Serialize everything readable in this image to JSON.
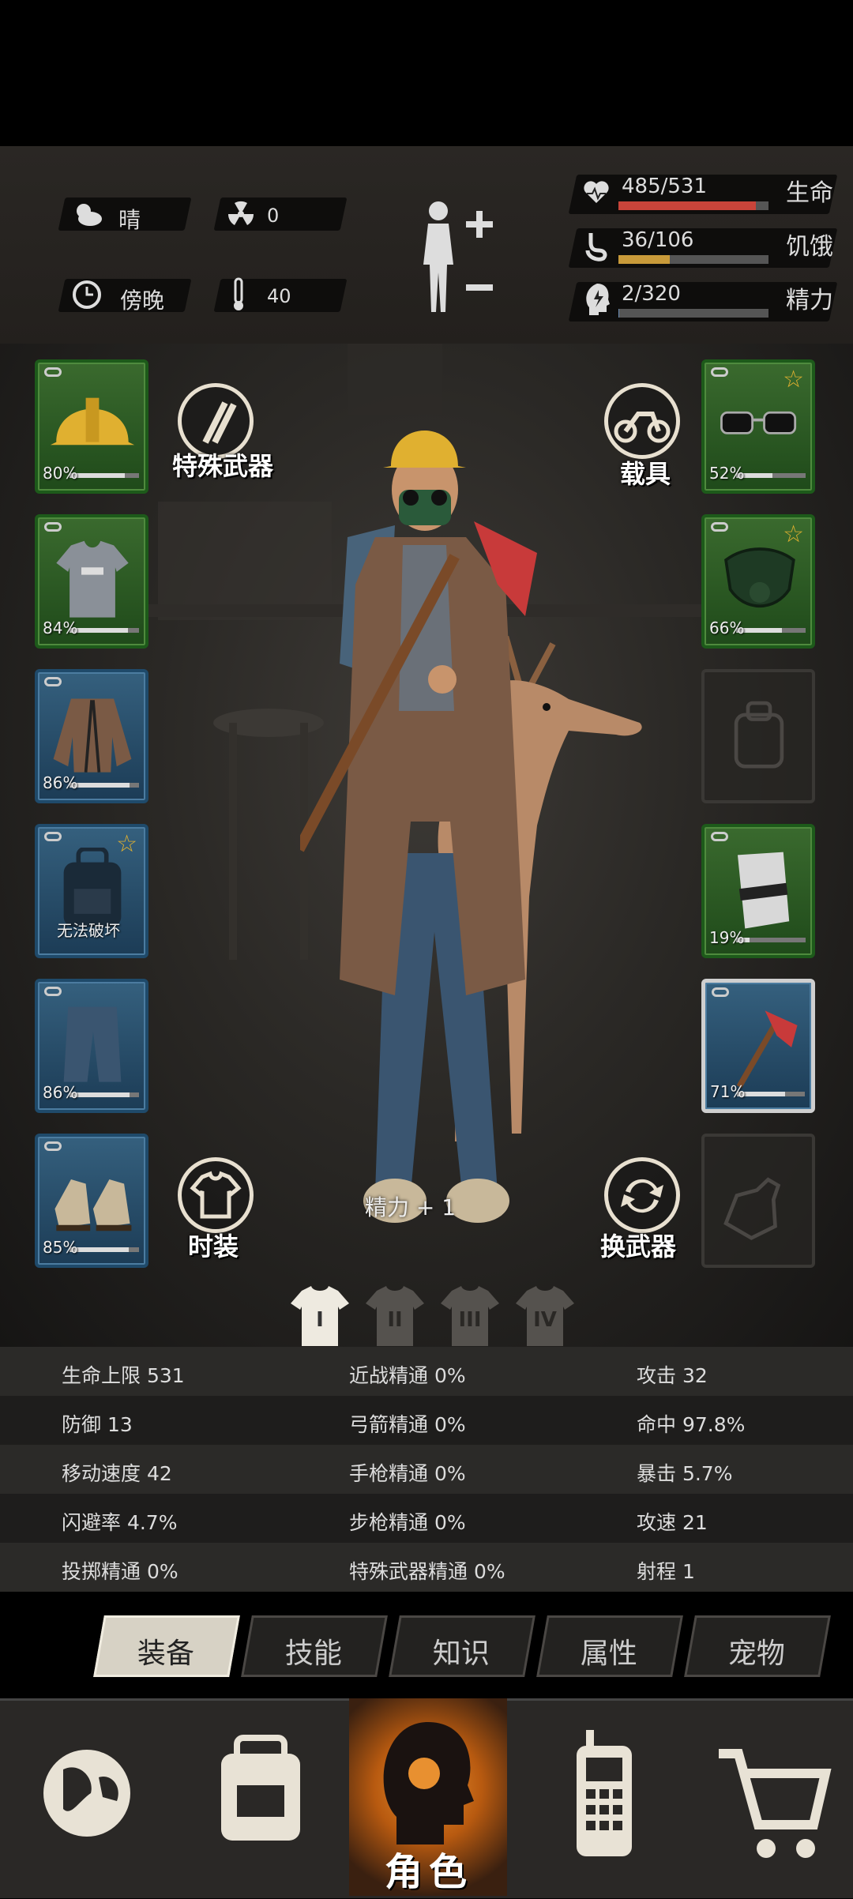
{
  "status": {
    "weather": "晴",
    "radiation": "0",
    "time_of_day": "傍晚",
    "temperature": "40",
    "health": {
      "label": "生命",
      "text": "485/531",
      "current": 485,
      "max": 531,
      "color": "#c8443a"
    },
    "hunger": {
      "label": "饥饿",
      "text": "36/106",
      "current": 36,
      "max": 106,
      "color": "#c89a3a"
    },
    "energy": {
      "label": "精力",
      "text": "2/320",
      "current": 2,
      "max": 320,
      "color": "#6a8ab0"
    }
  },
  "character": {
    "special_weapon_label": "特殊武器",
    "vehicle_label": "载具",
    "costume_label": "时装",
    "switch_weapon_label": "换武器",
    "shoe_bonus": "精力 + 1"
  },
  "left_slots": [
    {
      "icon": "hard-hat-icon",
      "pct": "80%",
      "value": 0.8,
      "rarity": "green",
      "star": false
    },
    {
      "icon": "tshirt-icon",
      "pct": "84%",
      "value": 0.84,
      "rarity": "green",
      "star": false
    },
    {
      "icon": "coat-icon",
      "pct": "86%",
      "value": 0.86,
      "rarity": "blue",
      "star": false
    },
    {
      "icon": "backpack-icon",
      "pct": "无法破坏",
      "rarity": "blue",
      "star": true
    },
    {
      "icon": "jeans-icon",
      "pct": "86%",
      "value": 0.86,
      "rarity": "blue",
      "star": false
    },
    {
      "icon": "sneakers-icon",
      "pct": "85%",
      "value": 0.85,
      "rarity": "blue",
      "star": false
    }
  ],
  "right_slots": [
    {
      "icon": "glasses-icon",
      "pct": "52%",
      "value": 0.52,
      "rarity": "green",
      "star": true
    },
    {
      "icon": "gas-mask-icon",
      "pct": "66%",
      "value": 0.66,
      "rarity": "green",
      "star": true
    },
    {
      "icon": "empty-pack-icon",
      "rarity": "empty"
    },
    {
      "icon": "bandage-roll-icon",
      "pct": "19%",
      "value": 0.19,
      "rarity": "green",
      "star": false
    },
    {
      "icon": "fire-axe-icon",
      "pct": "71%",
      "value": 0.71,
      "rarity": "blue",
      "star": false,
      "selected": true
    },
    {
      "icon": "empty-bottle-icon",
      "rarity": "empty"
    }
  ],
  "outfit_sets": [
    "I",
    "II",
    "III",
    "IV"
  ],
  "stats": [
    [
      "生命上限 531",
      "近战精通 0%",
      "攻击 32"
    ],
    [
      "防御 13",
      "弓箭精通 0%",
      "命中 97.8%"
    ],
    [
      "移动速度 42",
      "手枪精通 0%",
      "暴击 5.7%"
    ],
    [
      "闪避率 4.7%",
      "步枪精通 0%",
      "攻速 21"
    ],
    [
      "投掷精通 0%",
      "特殊武器精通 0%",
      "射程 1"
    ]
  ],
  "tabs": [
    "装备",
    "技能",
    "知识",
    "属性",
    "宠物"
  ],
  "active_tab": 0,
  "nav": {
    "items": [
      "world-map-icon",
      "backpack-icon",
      "character-icon",
      "radio-icon",
      "shop-cart-icon"
    ],
    "active_label": "角色"
  }
}
